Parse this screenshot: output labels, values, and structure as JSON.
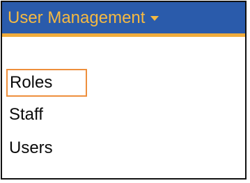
{
  "header": {
    "title": "User Management",
    "caret_icon": "caret-down-icon",
    "colors": {
      "background": "#2a5bab",
      "text": "#f5b942",
      "underline": "#f0ac3c"
    }
  },
  "menu": {
    "items": [
      {
        "label": "Roles",
        "focused": true
      },
      {
        "label": "Staff",
        "focused": false
      },
      {
        "label": "Users",
        "focused": false
      }
    ],
    "focus_color": "#ee8f3c"
  }
}
